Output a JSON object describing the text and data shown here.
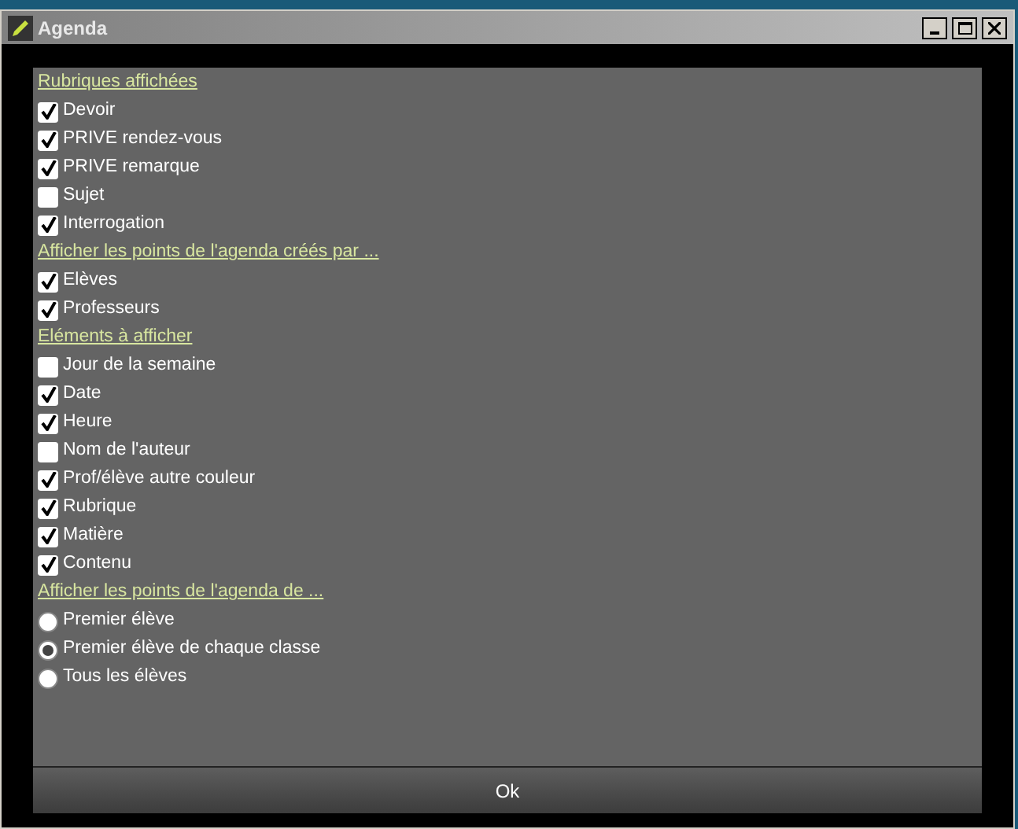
{
  "window": {
    "title": "Agenda"
  },
  "items": [
    {
      "kind": "heading",
      "label": "Rubriques affichées"
    },
    {
      "kind": "checkbox",
      "label": "Devoir",
      "checked": true
    },
    {
      "kind": "checkbox",
      "label": "PRIVE rendez-vous",
      "checked": true
    },
    {
      "kind": "checkbox",
      "label": "PRIVE remarque",
      "checked": true
    },
    {
      "kind": "checkbox",
      "label": "Sujet",
      "checked": false
    },
    {
      "kind": "checkbox",
      "label": "Interrogation",
      "checked": true
    },
    {
      "kind": "heading",
      "label": "Afficher les points de l'agenda créés par ..."
    },
    {
      "kind": "checkbox",
      "label": "Elèves",
      "checked": true
    },
    {
      "kind": "checkbox",
      "label": "Professeurs",
      "checked": true
    },
    {
      "kind": "heading",
      "label": "Eléments à afficher"
    },
    {
      "kind": "checkbox",
      "label": "Jour de la semaine",
      "checked": false
    },
    {
      "kind": "checkbox",
      "label": "Date",
      "checked": true
    },
    {
      "kind": "checkbox",
      "label": "Heure",
      "checked": true
    },
    {
      "kind": "checkbox",
      "label": "Nom de l'auteur",
      "checked": false
    },
    {
      "kind": "checkbox",
      "label": "Prof/élève autre couleur",
      "checked": true
    },
    {
      "kind": "checkbox",
      "label": "Rubrique",
      "checked": true
    },
    {
      "kind": "checkbox",
      "label": "Matière",
      "checked": true
    },
    {
      "kind": "checkbox",
      "label": "Contenu",
      "checked": true
    },
    {
      "kind": "heading",
      "label": "Afficher les points de l'agenda de ..."
    },
    {
      "kind": "radio",
      "label": "Premier élève",
      "selected": false
    },
    {
      "kind": "radio",
      "label": "Premier élève de chaque classe",
      "selected": true
    },
    {
      "kind": "radio",
      "label": "Tous les élèves",
      "selected": false
    }
  ],
  "ok_button": "Ok"
}
